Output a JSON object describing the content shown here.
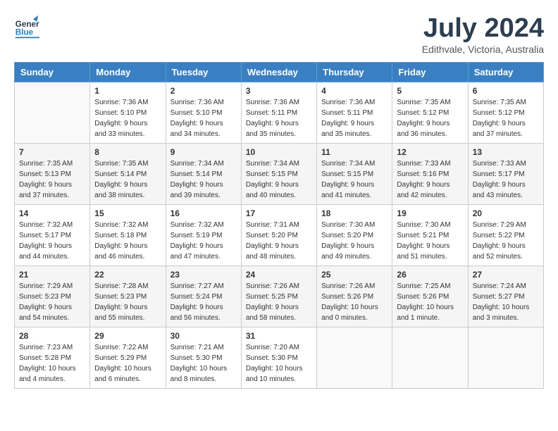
{
  "header": {
    "logo_general": "General",
    "logo_blue": "Blue",
    "month": "July 2024",
    "location": "Edithvale, Victoria, Australia"
  },
  "days_of_week": [
    "Sunday",
    "Monday",
    "Tuesday",
    "Wednesday",
    "Thursday",
    "Friday",
    "Saturday"
  ],
  "weeks": [
    [
      {
        "day": "",
        "info": ""
      },
      {
        "day": "1",
        "info": "Sunrise: 7:36 AM\nSunset: 5:10 PM\nDaylight: 9 hours\nand 33 minutes."
      },
      {
        "day": "2",
        "info": "Sunrise: 7:36 AM\nSunset: 5:10 PM\nDaylight: 9 hours\nand 34 minutes."
      },
      {
        "day": "3",
        "info": "Sunrise: 7:36 AM\nSunset: 5:11 PM\nDaylight: 9 hours\nand 35 minutes."
      },
      {
        "day": "4",
        "info": "Sunrise: 7:36 AM\nSunset: 5:11 PM\nDaylight: 9 hours\nand 35 minutes."
      },
      {
        "day": "5",
        "info": "Sunrise: 7:35 AM\nSunset: 5:12 PM\nDaylight: 9 hours\nand 36 minutes."
      },
      {
        "day": "6",
        "info": "Sunrise: 7:35 AM\nSunset: 5:12 PM\nDaylight: 9 hours\nand 37 minutes."
      }
    ],
    [
      {
        "day": "7",
        "info": "Sunrise: 7:35 AM\nSunset: 5:13 PM\nDaylight: 9 hours\nand 37 minutes."
      },
      {
        "day": "8",
        "info": "Sunrise: 7:35 AM\nSunset: 5:14 PM\nDaylight: 9 hours\nand 38 minutes."
      },
      {
        "day": "9",
        "info": "Sunrise: 7:34 AM\nSunset: 5:14 PM\nDaylight: 9 hours\nand 39 minutes."
      },
      {
        "day": "10",
        "info": "Sunrise: 7:34 AM\nSunset: 5:15 PM\nDaylight: 9 hours\nand 40 minutes."
      },
      {
        "day": "11",
        "info": "Sunrise: 7:34 AM\nSunset: 5:15 PM\nDaylight: 9 hours\nand 41 minutes."
      },
      {
        "day": "12",
        "info": "Sunrise: 7:33 AM\nSunset: 5:16 PM\nDaylight: 9 hours\nand 42 minutes."
      },
      {
        "day": "13",
        "info": "Sunrise: 7:33 AM\nSunset: 5:17 PM\nDaylight: 9 hours\nand 43 minutes."
      }
    ],
    [
      {
        "day": "14",
        "info": "Sunrise: 7:32 AM\nSunset: 5:17 PM\nDaylight: 9 hours\nand 44 minutes."
      },
      {
        "day": "15",
        "info": "Sunrise: 7:32 AM\nSunset: 5:18 PM\nDaylight: 9 hours\nand 46 minutes."
      },
      {
        "day": "16",
        "info": "Sunrise: 7:32 AM\nSunset: 5:19 PM\nDaylight: 9 hours\nand 47 minutes."
      },
      {
        "day": "17",
        "info": "Sunrise: 7:31 AM\nSunset: 5:20 PM\nDaylight: 9 hours\nand 48 minutes."
      },
      {
        "day": "18",
        "info": "Sunrise: 7:30 AM\nSunset: 5:20 PM\nDaylight: 9 hours\nand 49 minutes."
      },
      {
        "day": "19",
        "info": "Sunrise: 7:30 AM\nSunset: 5:21 PM\nDaylight: 9 hours\nand 51 minutes."
      },
      {
        "day": "20",
        "info": "Sunrise: 7:29 AM\nSunset: 5:22 PM\nDaylight: 9 hours\nand 52 minutes."
      }
    ],
    [
      {
        "day": "21",
        "info": "Sunrise: 7:29 AM\nSunset: 5:23 PM\nDaylight: 9 hours\nand 54 minutes."
      },
      {
        "day": "22",
        "info": "Sunrise: 7:28 AM\nSunset: 5:23 PM\nDaylight: 9 hours\nand 55 minutes."
      },
      {
        "day": "23",
        "info": "Sunrise: 7:27 AM\nSunset: 5:24 PM\nDaylight: 9 hours\nand 56 minutes."
      },
      {
        "day": "24",
        "info": "Sunrise: 7:26 AM\nSunset: 5:25 PM\nDaylight: 9 hours\nand 58 minutes."
      },
      {
        "day": "25",
        "info": "Sunrise: 7:26 AM\nSunset: 5:26 PM\nDaylight: 10 hours\nand 0 minutes."
      },
      {
        "day": "26",
        "info": "Sunrise: 7:25 AM\nSunset: 5:26 PM\nDaylight: 10 hours\nand 1 minute."
      },
      {
        "day": "27",
        "info": "Sunrise: 7:24 AM\nSunset: 5:27 PM\nDaylight: 10 hours\nand 3 minutes."
      }
    ],
    [
      {
        "day": "28",
        "info": "Sunrise: 7:23 AM\nSunset: 5:28 PM\nDaylight: 10 hours\nand 4 minutes."
      },
      {
        "day": "29",
        "info": "Sunrise: 7:22 AM\nSunset: 5:29 PM\nDaylight: 10 hours\nand 6 minutes."
      },
      {
        "day": "30",
        "info": "Sunrise: 7:21 AM\nSunset: 5:30 PM\nDaylight: 10 hours\nand 8 minutes."
      },
      {
        "day": "31",
        "info": "Sunrise: 7:20 AM\nSunset: 5:30 PM\nDaylight: 10 hours\nand 10 minutes."
      },
      {
        "day": "",
        "info": ""
      },
      {
        "day": "",
        "info": ""
      },
      {
        "day": "",
        "info": ""
      }
    ]
  ]
}
